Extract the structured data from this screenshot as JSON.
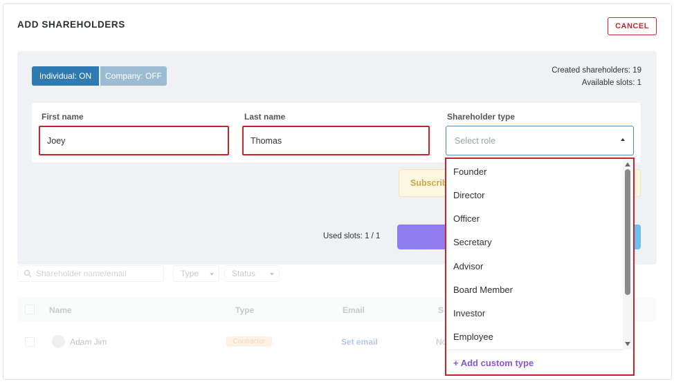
{
  "header": {
    "title": "ADD SHAREHOLDERS",
    "cancel_label": "CANCEL"
  },
  "toggles": {
    "individual": "Individual: ON",
    "company": "Company: OFF"
  },
  "stats": {
    "created": "Created shareholders: 19",
    "available": "Available slots: 1"
  },
  "form": {
    "first_name_label": "First name",
    "first_name_value": "Joey",
    "last_name_label": "Last name",
    "last_name_value": "Thomas",
    "type_label": "Shareholder type",
    "type_placeholder": "Select role"
  },
  "subscription_notice": "Subscrib",
  "used_slots": "Used slots: 1 / 1",
  "dropdown": {
    "options": [
      "Founder",
      "Director",
      "Officer",
      "Secretary",
      "Advisor",
      "Board Member",
      "Investor",
      "Employee"
    ],
    "add_custom": "+ Add custom type"
  },
  "filters": {
    "search_placeholder": "Shareholder name/email",
    "type": "Type",
    "status": "Status"
  },
  "table": {
    "headers": [
      "Name",
      "Type",
      "Email",
      "S"
    ],
    "rows": [
      {
        "name": "Adam Jim",
        "type": "Contractor",
        "email": "Set email",
        "status": "No"
      }
    ]
  },
  "colors": {
    "accent_blue": "#2f7ab0",
    "danger_red": "#c0282e",
    "custom_purple": "#8a54d2"
  }
}
